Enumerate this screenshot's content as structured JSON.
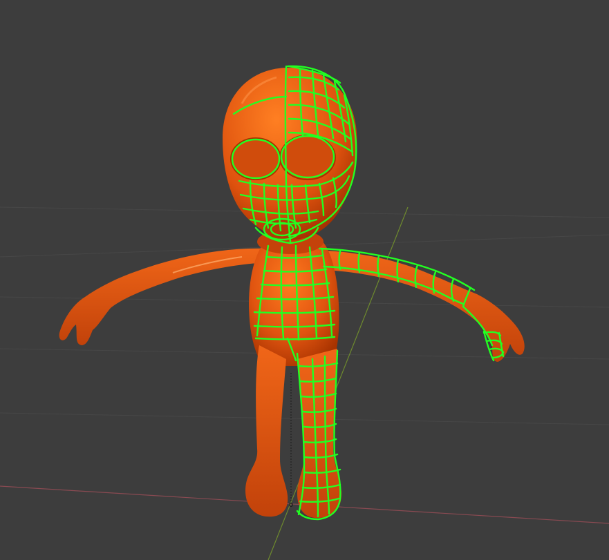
{
  "viewport": {
    "background_color": "#3d3d3d",
    "grid_color": "#474747",
    "x_axis_color": "#8a4a52",
    "y_axis_color": "#6e8a2e",
    "mesh_color": "#e85a0e",
    "mesh_shade_color": "#a83300",
    "annotation_color": "#22ff22",
    "origin_marker_color": "#1a1a1a"
  },
  "object": {
    "kind": "character-mesh",
    "shading": "solid-orange",
    "overlay": "grease-pencil-retopology-strokes"
  }
}
